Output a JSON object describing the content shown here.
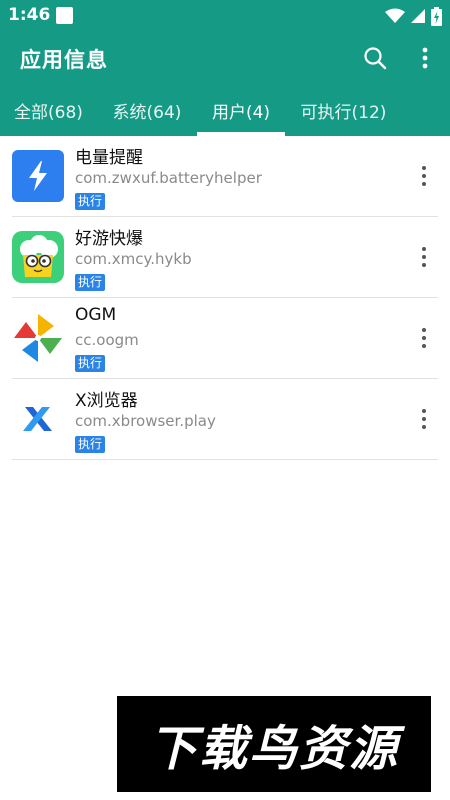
{
  "status_bar": {
    "time": "1:46",
    "icons": [
      "notification-square-icon",
      "wifi-icon",
      "cellular-signal-icon",
      "battery-charging-icon"
    ]
  },
  "app_bar": {
    "title": "应用信息",
    "icons": [
      "search-icon",
      "more-vert-icon"
    ]
  },
  "tabs": [
    {
      "label": "全部(68)",
      "active": false
    },
    {
      "label": "系统(64)",
      "active": false
    },
    {
      "label": "用户(4)",
      "active": true
    },
    {
      "label": "可执行(12)",
      "active": false
    }
  ],
  "apps": [
    {
      "name": "电量提醒",
      "package": "com.zwxuf.batteryhelper",
      "badge": "执行",
      "icon": "battery-helper-icon"
    },
    {
      "name": "好游快爆",
      "package": "com.xmcy.hykb",
      "badge": "执行",
      "icon": "hykb-icon"
    },
    {
      "name": "OGM",
      "package": "cc.oogm",
      "badge": "执行",
      "icon": "ogm-pinwheel-icon"
    },
    {
      "name": "X浏览器",
      "package": "com.xbrowser.play",
      "badge": "执行",
      "icon": "x-browser-icon"
    }
  ],
  "watermark": {
    "text": "下载鸟资源"
  },
  "colors": {
    "primary": "#159a86",
    "badge": "#2a83e6",
    "indicator": "#ffffff"
  }
}
